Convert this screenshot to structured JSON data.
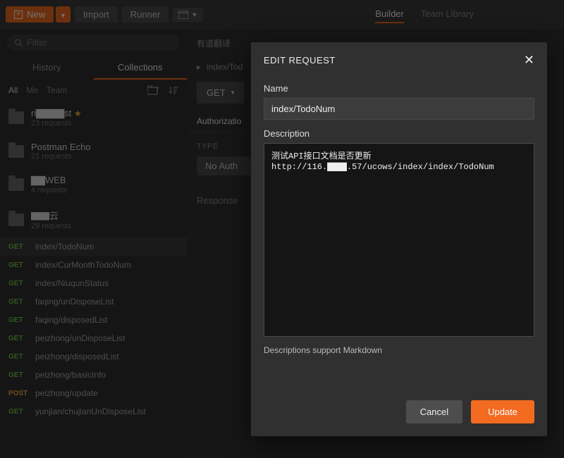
{
  "topbar": {
    "new_label": "New",
    "import_label": "Import",
    "runner_label": "Runner",
    "tabs": {
      "builder": "Builder",
      "team_library": "Team Library",
      "active": "builder"
    }
  },
  "sidebar": {
    "filter_placeholder": "Filter",
    "tabs": {
      "history": "History",
      "collections": "Collections",
      "active": "collections"
    },
    "scopes": {
      "all": "All",
      "me": "Me",
      "team": "Team",
      "active": "all"
    },
    "collections": [
      {
        "name": "ri▇▇▇▇st",
        "sub": "23 requests",
        "starred": true
      },
      {
        "name": "Postman Echo",
        "sub": "21 requests",
        "starred": false
      },
      {
        "name": "▇▇WEB",
        "sub": "4 requests",
        "starred": false
      },
      {
        "name": "▇▇云",
        "sub": "29 requests",
        "starred": false
      }
    ],
    "requests": [
      {
        "method": "GET",
        "name": "index/TodoNum",
        "selected": true
      },
      {
        "method": "GET",
        "name": "index/CurMonthTodoNum"
      },
      {
        "method": "GET",
        "name": "index/NiuqunStatus"
      },
      {
        "method": "GET",
        "name": "faqing/unDisposeList"
      },
      {
        "method": "GET",
        "name": "faqing/disposedList"
      },
      {
        "method": "GET",
        "name": "peizhong/unDisposeList"
      },
      {
        "method": "GET",
        "name": "peizhong/disposedList"
      },
      {
        "method": "GET",
        "name": "peizhong/basicInfo"
      },
      {
        "method": "POST",
        "name": "peizhong/update"
      },
      {
        "method": "GET",
        "name": "yunjian/chujianUnDisposeList"
      }
    ]
  },
  "main": {
    "translate_hint": "有道翻译",
    "breadcrumb": "index/Tod",
    "http_method": "GET",
    "request_tabs": {
      "authorization": "Authorizatio",
      "active": "authorization"
    },
    "type_label": "TYPE",
    "auth_value": "No Auth",
    "response_label": "Response"
  },
  "modal": {
    "title": "EDIT REQUEST",
    "name_label": "Name",
    "name_value": "index/TodoNum",
    "desc_label": "Description",
    "desc_value": "测试API接口文档是否更新\nhttp://116.▇▇▇.57/ucows/index/index/TodoNum",
    "hint": "Descriptions support Markdown",
    "cancel": "Cancel",
    "update": "Update"
  }
}
